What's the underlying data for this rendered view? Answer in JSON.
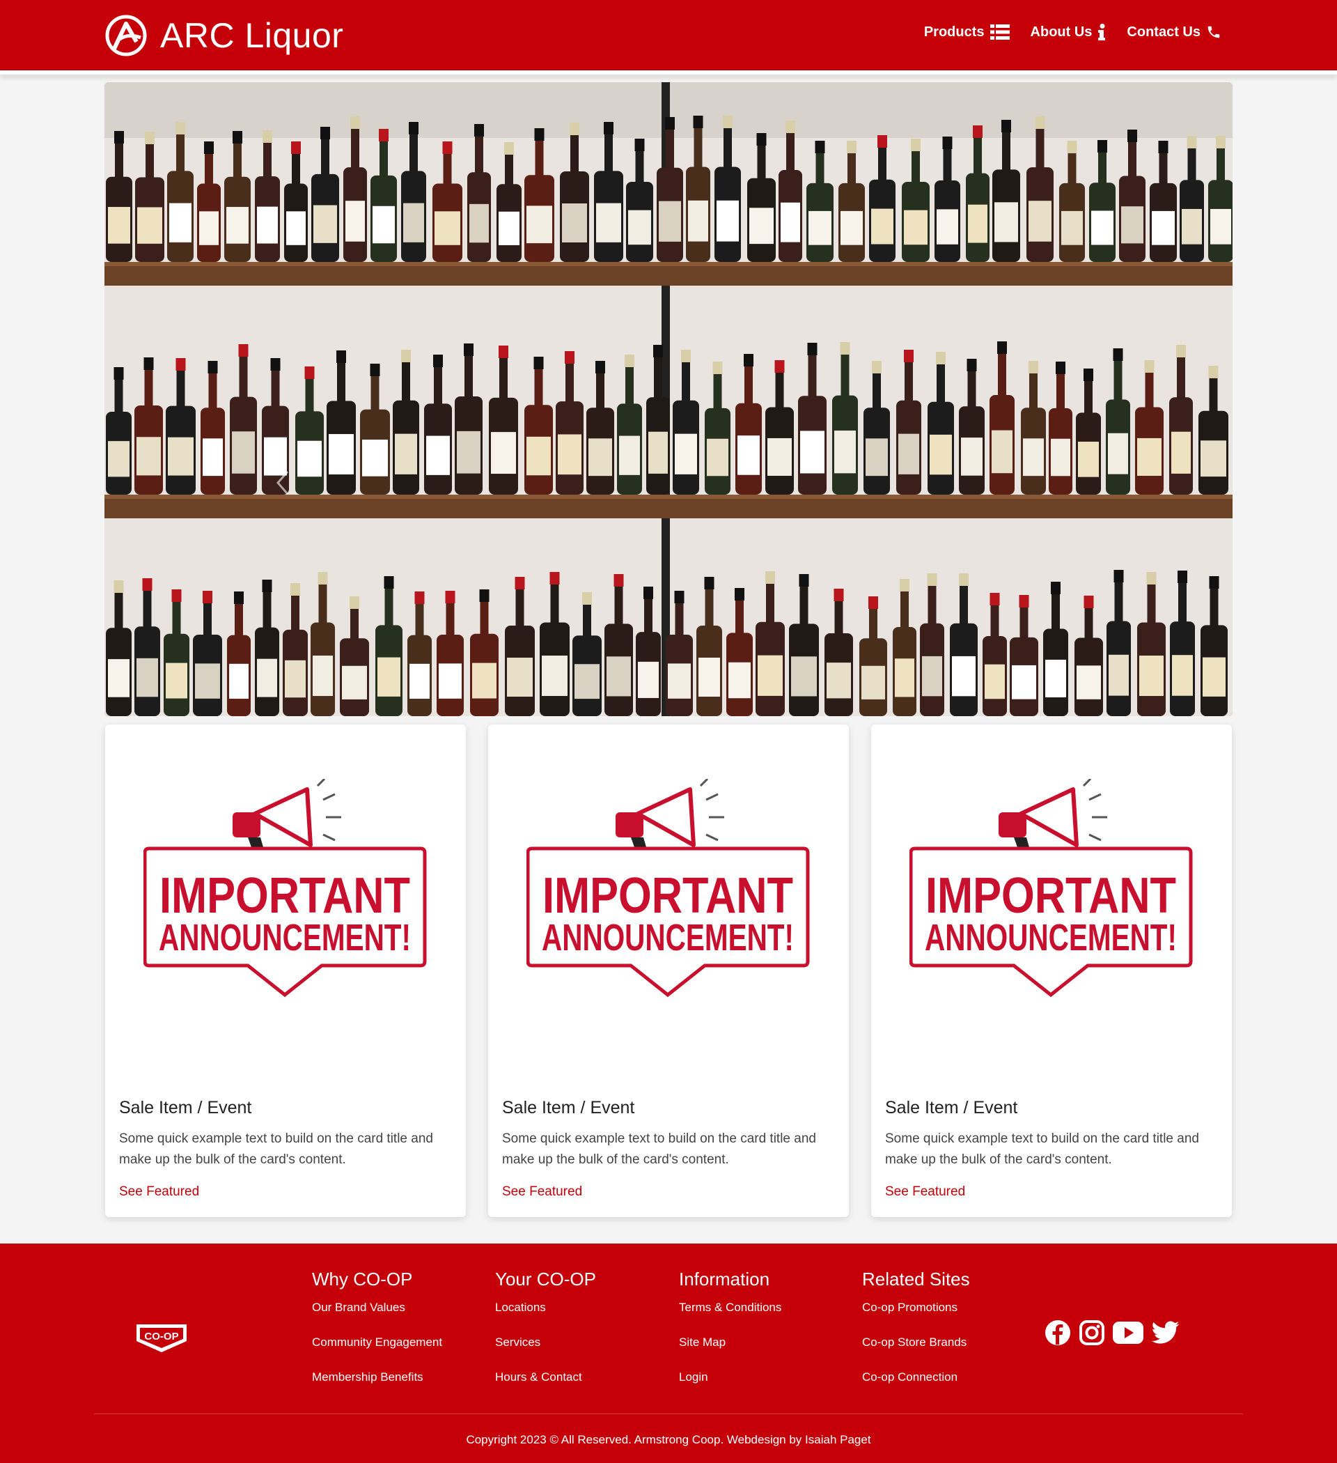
{
  "navbar": {
    "brand": "ARC Liquor",
    "links": [
      {
        "label": "Products",
        "icon": "list-icon"
      },
      {
        "label": "About Us",
        "icon": "info-icon"
      },
      {
        "label": "Contact Us",
        "icon": "phone-icon"
      }
    ]
  },
  "hero": {
    "image": "wine-bottles-on-shelves",
    "controls": {
      "prev": "chevron-left-icon",
      "next": "chevron-right-icon"
    }
  },
  "cards": [
    {
      "image_text_1": "IMPORTANT",
      "image_text_2": "ANNOUNCEMENT!",
      "title": "Sale Item / Event",
      "text": "Some quick example text to build on the card title and make up the bulk of the card's content.",
      "link": "See Featured"
    },
    {
      "image_text_1": "IMPORTANT",
      "image_text_2": "ANNOUNCEMENT!",
      "title": "Sale Item / Event",
      "text": "Some quick example text to build on the card title and make up the bulk of the card's content.",
      "link": "See Featured"
    },
    {
      "image_text_1": "IMPORTANT",
      "image_text_2": "ANNOUNCEMENT!",
      "title": "Sale Item / Event",
      "text": "Some quick example text to build on the card title and make up the bulk of the card's content.",
      "link": "See Featured"
    }
  ],
  "footer": {
    "logo_text": "CO-OP",
    "columns": [
      {
        "heading": "Why CO-OP",
        "links": [
          "Our Brand Values",
          "Community Engagement",
          "Membership Benefits"
        ]
      },
      {
        "heading": "Your CO-OP",
        "links": [
          "Locations",
          "Services",
          "Hours & Contact"
        ]
      },
      {
        "heading": "Information",
        "links": [
          "Terms & Conditions",
          "Site Map",
          "Login"
        ]
      },
      {
        "heading": "Related Sites",
        "links": [
          "Co-op Promotions",
          "Co-op Store Brands",
          "Co-op Connection"
        ]
      }
    ],
    "social": [
      "facebook-icon",
      "instagram-icon",
      "youtube-icon",
      "twitter-icon"
    ],
    "copyright": "Copyright 2023 © All Reserved. Armstrong Coop. Webdesign by Isaiah Paget"
  },
  "colors": {
    "brand_red": "#c50008",
    "background": "#f4f4f4",
    "card_bg": "#ffffff"
  }
}
